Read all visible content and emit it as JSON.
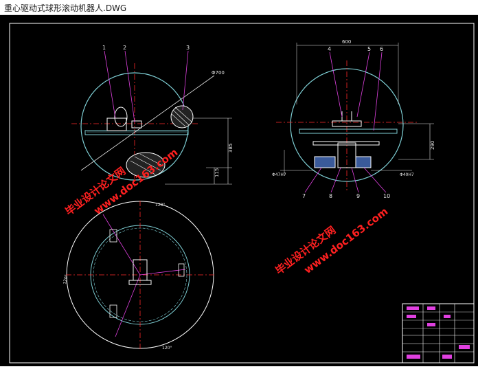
{
  "window": {
    "title": "重心驱动式球形滚动机器人.DWG"
  },
  "drawing": {
    "part_labels": [
      "1",
      "2",
      "3",
      "4",
      "5",
      "6",
      "7",
      "8",
      "9",
      "10"
    ],
    "dimensions": {
      "front_diameter": "Φ700",
      "front_height_1": "385",
      "front_height_2": "115",
      "side_width": "600",
      "side_height": "290",
      "side_fit_left": "Φ47H7",
      "side_fit_right": "Φ40H7",
      "plan_angle_top": "120°",
      "plan_angle_left": "120°",
      "plan_angle_bottom": "120°"
    },
    "watermark": {
      "text_cn": "毕业设计论文网",
      "text_url": "www.doc163.com"
    }
  },
  "colors": {
    "background": "#000000",
    "frame": "#ffffff",
    "sphere": "#7fd0d6",
    "centerline": "#ff2a2a",
    "leader": "#e040e0",
    "dimension": "#e8e8e8",
    "watermark": "#ff2020",
    "part": "#d0d0d0",
    "accent": "#4a78c8"
  }
}
